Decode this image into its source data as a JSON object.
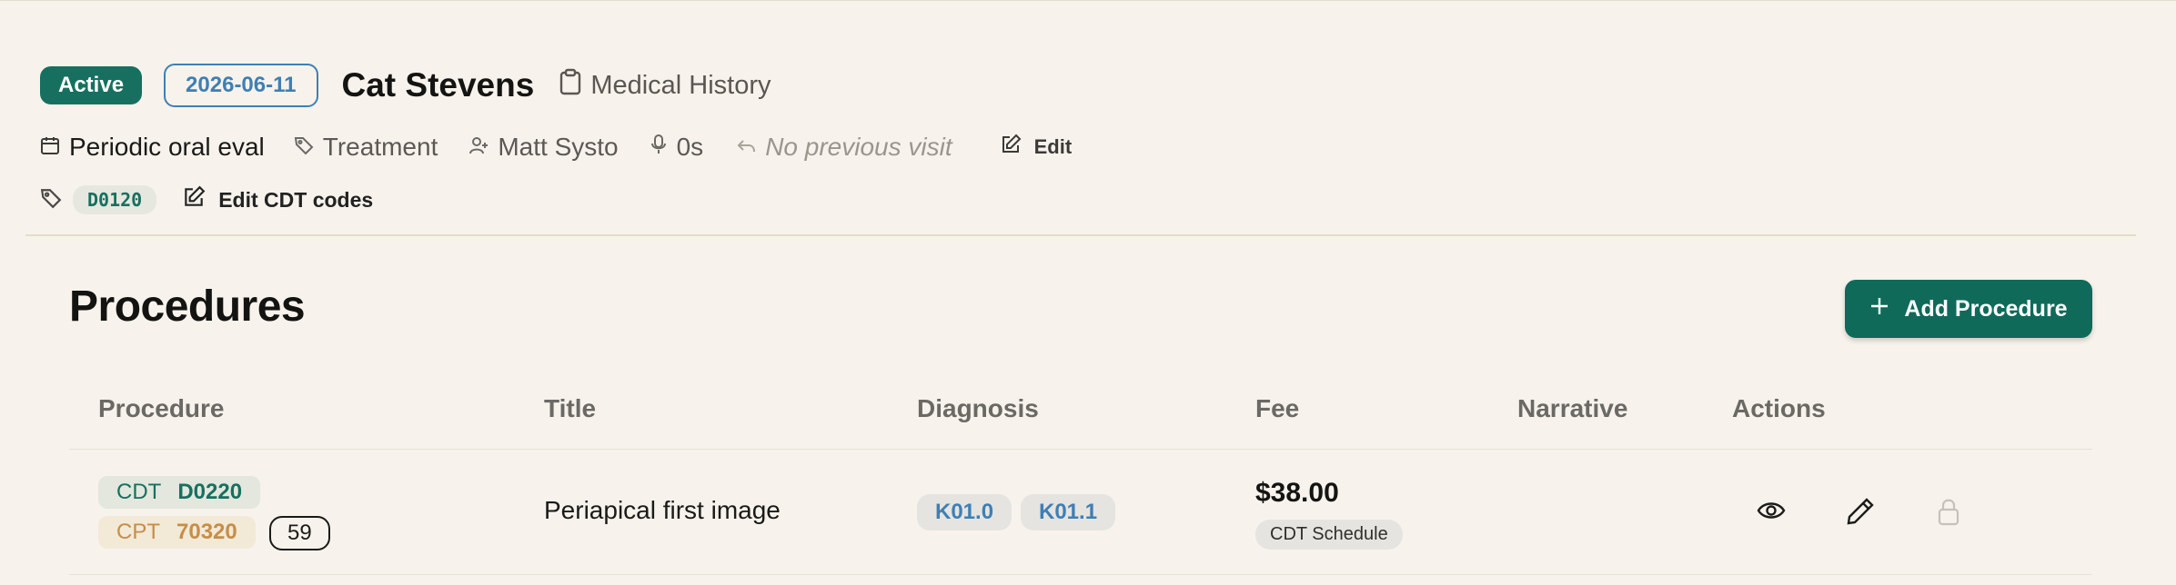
{
  "header": {
    "status_badge": "Active",
    "date_badge": "2026-06-11",
    "patient_name": "Cat Stevens",
    "medical_history_link": "Medical History"
  },
  "visit_meta": {
    "visit_type": "Periodic oral eval",
    "category": "Treatment",
    "provider": "Matt Systo",
    "recording_duration": "0s",
    "previous_visit": "No previous visit",
    "edit_label": "Edit"
  },
  "codes": {
    "visit_code": "D0120",
    "edit_cdt_label": "Edit CDT codes"
  },
  "procedures": {
    "title": "Procedures",
    "add_button_label": "Add Procedure",
    "columns": [
      "Procedure",
      "Title",
      "Diagnosis",
      "Fee",
      "Narrative",
      "Actions"
    ],
    "rows": [
      {
        "cdt_system": "CDT",
        "cdt_code": "D0220",
        "cpt_system": "CPT",
        "cpt_code": "70320",
        "count": "59",
        "title": "Periapical first image",
        "diagnoses": [
          "K01.0",
          "K01.1"
        ],
        "fee": "$38.00",
        "fee_schedule": "CDT Schedule",
        "narrative": ""
      }
    ]
  },
  "icons": {
    "medical_history": "clipboard-icon",
    "visit_type": "calendar-icon",
    "category": "tag-icon",
    "provider": "user-icon",
    "recording": "microphone-icon",
    "previous_visit": "undo-arrow-icon",
    "edit": "pencil-square-icon",
    "add": "plus-icon",
    "view": "eye-icon",
    "edit_row": "pencil-icon",
    "lock": "lock-icon"
  },
  "colors": {
    "accent_green": "#0f6a5a",
    "date_blue": "#3f7fb4",
    "cpt_orange": "#c58e49",
    "background": "#f7f3ec"
  }
}
